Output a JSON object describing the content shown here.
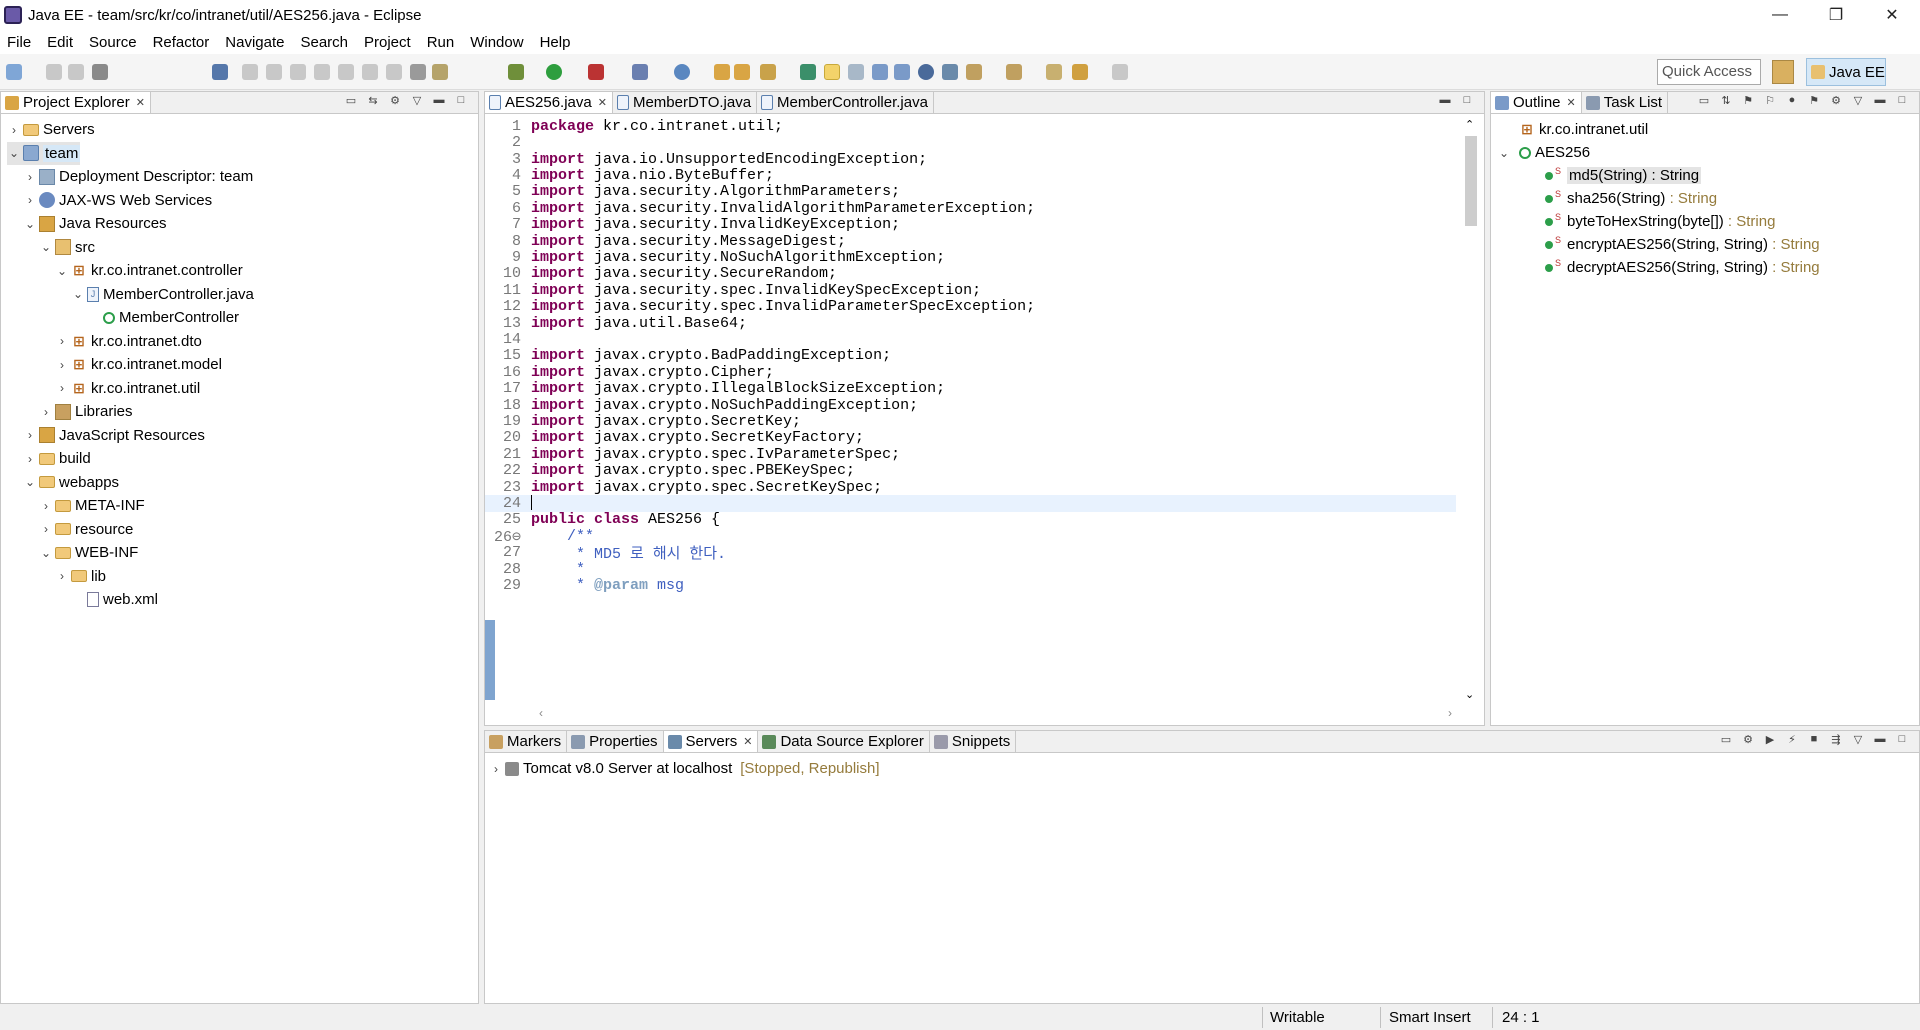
{
  "window": {
    "title": "Java EE - team/src/kr/co/intranet/util/AES256.java - Eclipse",
    "minimize": "—",
    "restore": "❐",
    "close": "✕"
  },
  "menu": [
    "File",
    "Edit",
    "Source",
    "Refactor",
    "Navigate",
    "Search",
    "Project",
    "Run",
    "Window",
    "Help"
  ],
  "toolbar": {
    "quick_access_placeholder": "Quick Access",
    "perspective": "Java EE"
  },
  "project_explorer": {
    "tab_label": "Project Explorer",
    "items": [
      {
        "label": "Servers",
        "arrow": "›",
        "icon": "folder-icon"
      },
      {
        "label": "team",
        "arrow": "⌄",
        "icon": "project-icon"
      },
      {
        "label": "Deployment Descriptor: team",
        "arrow": "›",
        "icon": "descriptor-icon"
      },
      {
        "label": "JAX-WS Web Services",
        "arrow": "›",
        "icon": "webservice-icon"
      },
      {
        "label": "Java Resources",
        "arrow": "⌄",
        "icon": "java-resources-icon"
      },
      {
        "label": "src",
        "arrow": "⌄",
        "icon": "source-folder-icon"
      },
      {
        "label": "kr.co.intranet.controller",
        "arrow": "⌄",
        "icon": "package-icon"
      },
      {
        "label": "MemberController.java",
        "arrow": "⌄",
        "icon": "java-file-icon"
      },
      {
        "label": "MemberController",
        "arrow": "",
        "icon": "class-icon"
      },
      {
        "label": "kr.co.intranet.dto",
        "arrow": "›",
        "icon": "package-icon"
      },
      {
        "label": "kr.co.intranet.model",
        "arrow": "›",
        "icon": "package-icon"
      },
      {
        "label": "kr.co.intranet.util",
        "arrow": "›",
        "icon": "package-icon"
      },
      {
        "label": "Libraries",
        "arrow": "›",
        "icon": "library-icon"
      },
      {
        "label": "JavaScript Resources",
        "arrow": "›",
        "icon": "js-resources-icon"
      },
      {
        "label": "build",
        "arrow": "›",
        "icon": "folder-icon"
      },
      {
        "label": "webapps",
        "arrow": "⌄",
        "icon": "folder-icon"
      },
      {
        "label": "META-INF",
        "arrow": "›",
        "icon": "folder-icon"
      },
      {
        "label": "resource",
        "arrow": "›",
        "icon": "folder-icon"
      },
      {
        "label": "WEB-INF",
        "arrow": "⌄",
        "icon": "folder-icon"
      },
      {
        "label": "lib",
        "arrow": "›",
        "icon": "folder-icon"
      },
      {
        "label": "web.xml",
        "arrow": "",
        "icon": "xml-file-icon"
      }
    ]
  },
  "editor": {
    "tabs": [
      {
        "label": "AES256.java",
        "close": "✕"
      },
      {
        "label": "MemberDTO.java"
      },
      {
        "label": "MemberController.java"
      }
    ],
    "lines": [
      {
        "n": "1",
        "kw": "package",
        "text": " kr.co.intranet.util;"
      },
      {
        "n": "2",
        "kw": "",
        "text": ""
      },
      {
        "n": "3",
        "kw": "import",
        "text": " java.io.UnsupportedEncodingException;"
      },
      {
        "n": "4",
        "kw": "import",
        "text": " java.nio.ByteBuffer;"
      },
      {
        "n": "5",
        "kw": "import",
        "text": " java.security.AlgorithmParameters;"
      },
      {
        "n": "6",
        "kw": "import",
        "text": " java.security.InvalidAlgorithmParameterException;"
      },
      {
        "n": "7",
        "kw": "import",
        "text": " java.security.InvalidKeyException;"
      },
      {
        "n": "8",
        "kw": "import",
        "text": " java.security.MessageDigest;"
      },
      {
        "n": "9",
        "kw": "import",
        "text": " java.security.NoSuchAlgorithmException;"
      },
      {
        "n": "10",
        "kw": "import",
        "text": " java.security.SecureRandom;"
      },
      {
        "n": "11",
        "kw": "import",
        "text": " java.security.spec.InvalidKeySpecException;"
      },
      {
        "n": "12",
        "kw": "import",
        "text": " java.security.spec.InvalidParameterSpecException;"
      },
      {
        "n": "13",
        "kw": "import",
        "text": " java.util.Base64;"
      },
      {
        "n": "14",
        "kw": "",
        "text": ""
      },
      {
        "n": "15",
        "kw": "import",
        "text": " javax.crypto.BadPaddingException;"
      },
      {
        "n": "16",
        "kw": "import",
        "text": " javax.crypto.Cipher;"
      },
      {
        "n": "17",
        "kw": "import",
        "text": " javax.crypto.IllegalBlockSizeException;"
      },
      {
        "n": "18",
        "kw": "import",
        "text": " javax.crypto.NoSuchPaddingException;"
      },
      {
        "n": "19",
        "kw": "import",
        "text": " javax.crypto.SecretKey;"
      },
      {
        "n": "20",
        "kw": "import",
        "text": " javax.crypto.SecretKeyFactory;"
      },
      {
        "n": "21",
        "kw": "import",
        "text": " javax.crypto.spec.IvParameterSpec;"
      },
      {
        "n": "22",
        "kw": "import",
        "text": " javax.crypto.spec.PBEKeySpec;"
      },
      {
        "n": "23",
        "kw": "import",
        "text": " javax.crypto.spec.SecretKeySpec;"
      },
      {
        "n": "24",
        "kw": "",
        "text": ""
      },
      {
        "n": "25",
        "kw": "public class",
        "text": " AES256 {"
      },
      {
        "n": "26⊖",
        "kw": "",
        "text": "    /**",
        "comment": true
      },
      {
        "n": "27",
        "kw": "",
        "text": "     * MD5 로 해시 한다.",
        "comment": true
      },
      {
        "n": "28",
        "kw": "",
        "text": "     *",
        "comment": true
      },
      {
        "n": "29",
        "kw": "",
        "text": "     * ",
        "comment": true,
        "tag": "@param",
        "tail": " msg"
      }
    ]
  },
  "outline": {
    "tabs": [
      {
        "label": "Outline",
        "close": "✕"
      },
      {
        "label": "Task List"
      }
    ],
    "package": "kr.co.intranet.util",
    "class_name": "AES256",
    "methods": [
      {
        "name": "md5(String)",
        "ret": " : String"
      },
      {
        "name": "sha256(String)",
        "ret": " : String"
      },
      {
        "name": "byteToHexString(byte[])",
        "ret": " : String"
      },
      {
        "name": "encryptAES256(String, String)",
        "ret": " : String"
      },
      {
        "name": "decryptAES256(String, String)",
        "ret": " : String"
      }
    ]
  },
  "bottom": {
    "tabs": [
      {
        "label": "Markers"
      },
      {
        "label": "Properties"
      },
      {
        "label": "Servers",
        "close": "✕"
      },
      {
        "label": "Data Source Explorer"
      },
      {
        "label": "Snippets"
      }
    ],
    "server": {
      "name": "Tomcat v8.0 Server at localhost",
      "state": "[Stopped, Republish]"
    }
  },
  "status": {
    "writable": "Writable",
    "insert_mode": "Smart Insert",
    "position": "24 : 1"
  },
  "colors": {
    "keyword": "#7f0055",
    "comment": "#3f5fbf",
    "selection": "#d6e8f7"
  }
}
